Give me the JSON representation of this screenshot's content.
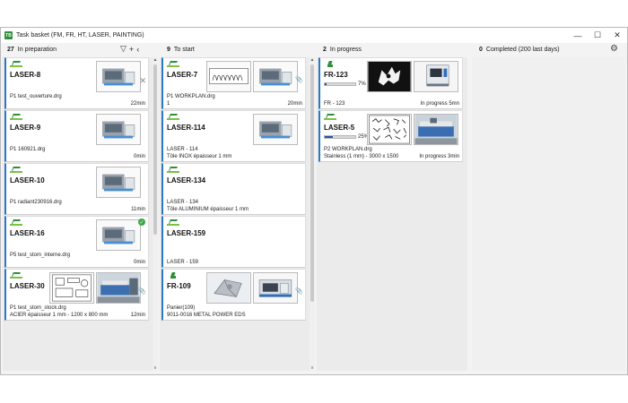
{
  "window": {
    "app_icon": "TB",
    "title": "Task basket (FM, FR, HT, LASER, PAINTING)",
    "controls": [
      "—",
      "☐",
      "✕"
    ]
  },
  "columns": [
    {
      "count": "27",
      "label": "In preparation"
    },
    {
      "count": "9",
      "label": "To start"
    },
    {
      "count": "2",
      "label": "In progress"
    },
    {
      "count": "0",
      "label": "Completed (200 last days)"
    }
  ],
  "tools": {
    "filter_icon": "▽",
    "add_icon": "+",
    "collapse_icon": "‹",
    "settings_icon": "⚙"
  },
  "scroll": {
    "up": "▲",
    "down": "∨"
  },
  "preparation": [
    {
      "name": "LASER-8",
      "line1": "P1 test_ouverture.drg",
      "line2": "",
      "time": "22min",
      "side": "✕",
      "check": false
    },
    {
      "name": "LASER-9",
      "line1": "P1 160921.drg",
      "line2": "",
      "time": "0min",
      "side": "",
      "check": false
    },
    {
      "name": "LASER-10",
      "line1": "P1 radiant230916.drg",
      "line2": "",
      "time": "11min",
      "side": "",
      "check": false
    },
    {
      "name": "LASER-16",
      "line1": "P5 test_stom_interne.drg",
      "line2": "",
      "time": "0min",
      "side": "",
      "check": true
    },
    {
      "name": "LASER-30",
      "line1": "P1 test_stom_stock.drg",
      "line2": "ACIER épaisseur 1 mm - 1200 x 800 mm",
      "time": "12min",
      "side": "📎",
      "check": false
    }
  ],
  "to_start": [
    {
      "name": "LASER-7",
      "line1": "P1 WORKPLAN.drg",
      "line2": "1",
      "time": "20min",
      "side": "📎"
    },
    {
      "name": "LASER-114",
      "line1": "LASER - 114",
      "line2": "Tôle INOX épaisseur 1 mm",
      "time": "",
      "side": ""
    },
    {
      "name": "LASER-134",
      "line1": "LASER - 134",
      "line2": "Tôle ALUMINIUM épaisseur 1 mm",
      "time": "",
      "side": ""
    },
    {
      "name": "LASER-159",
      "line1": "",
      "line2": "LASER - 159",
      "time": "",
      "side": ""
    },
    {
      "name": "FR-109",
      "line1": "Panier(109)",
      "line2": "9011-0016 METAL POWER EDS",
      "time": "",
      "side": "📎"
    }
  ],
  "in_progress": [
    {
      "name": "FR-123",
      "pct": "7%",
      "pct_value": 7,
      "line1": "",
      "line2": "FR - 123",
      "time": "In progress 5mn"
    },
    {
      "name": "LASER-5",
      "pct": "25%",
      "pct_value": 25,
      "line1": "P2 WORKPLAN.drg",
      "line2": "Stainless (1 mm) - 3000 x 1500",
      "time": "In progress 3min"
    }
  ]
}
